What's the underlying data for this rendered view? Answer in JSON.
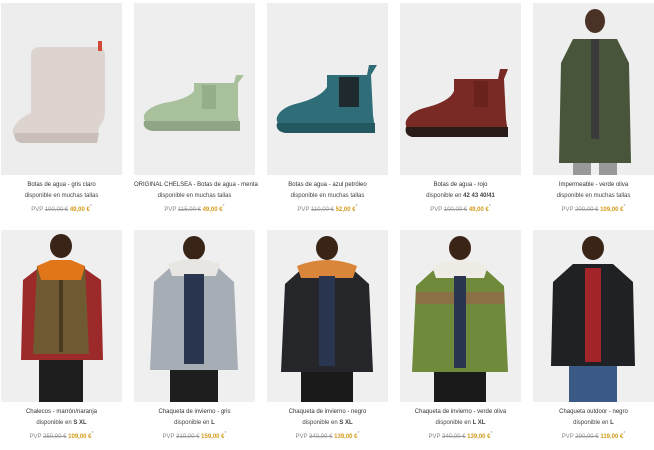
{
  "products": [
    {
      "title": "Botas de agua - gris claro",
      "avail_prefix": "disponible en muchas tallas",
      "avail_sizes": "",
      "pvp": "PVP",
      "old_price": "100,00 €",
      "new_price": "49,00 €",
      "asterisk": "*",
      "image": "boot-gray"
    },
    {
      "title": "ORIGINAL CHELSEA - Botas de agua - menta",
      "avail_prefix": "disponible en muchas tallas",
      "avail_sizes": "",
      "pvp": "PVP",
      "old_price": "115,00 €",
      "new_price": "49,00 €",
      "asterisk": "*",
      "image": "chelsea-mint"
    },
    {
      "title": "Botas de agua - azul petróleo",
      "avail_prefix": "disponible en muchas tallas",
      "avail_sizes": "",
      "pvp": "PVP",
      "old_price": "110,00 €",
      "new_price": "52,00 €",
      "asterisk": "*",
      "image": "chelsea-teal"
    },
    {
      "title": "Botas de agua - rojo",
      "avail_prefix": "disponible en ",
      "avail_sizes": "42 43 40/41",
      "pvp": "PVP",
      "old_price": "100,00 €",
      "new_price": "49,00 €",
      "asterisk": "*",
      "image": "chelsea-red"
    },
    {
      "title": "Impermeable - verde oliva",
      "avail_prefix": "disponible en muchas tallas",
      "avail_sizes": "",
      "pvp": "PVP",
      "old_price": "200,00 €",
      "new_price": "109,00 €",
      "asterisk": "*",
      "image": "raincoat-olive"
    },
    {
      "title": "Chalecos - marrón/naranja",
      "avail_prefix": "disponible en ",
      "avail_sizes": "S XL",
      "pvp": "PVP",
      "old_price": "250,00 €",
      "new_price": "109,00 €",
      "asterisk": "*",
      "image": "vest-orange"
    },
    {
      "title": "Chaqueta de invierno - gris",
      "avail_prefix": "disponible en ",
      "avail_sizes": "L",
      "pvp": "PVP",
      "old_price": "310,00 €",
      "new_price": "159,00 €",
      "asterisk": "*",
      "image": "jacket-gray"
    },
    {
      "title": "Chaqueta de invierno - negro",
      "avail_prefix": "disponible en ",
      "avail_sizes": "S XL",
      "pvp": "PVP",
      "old_price": "340,00 €",
      "new_price": "139,00 €",
      "asterisk": "*",
      "image": "jacket-black-fur"
    },
    {
      "title": "Chaqueta de invierno - verde oliva",
      "avail_prefix": "disponible en ",
      "avail_sizes": "L XL",
      "pvp": "PVP",
      "old_price": "340,00 €",
      "new_price": "139,00 €",
      "asterisk": "*",
      "image": "jacket-olive"
    },
    {
      "title": "Chaqueta outdoor - negro",
      "avail_prefix": "disponible en ",
      "avail_sizes": "L",
      "pvp": "PVP",
      "old_price": "290,00 €",
      "new_price": "119,00 €",
      "asterisk": "*",
      "image": "jacket-black-outdoor"
    }
  ]
}
